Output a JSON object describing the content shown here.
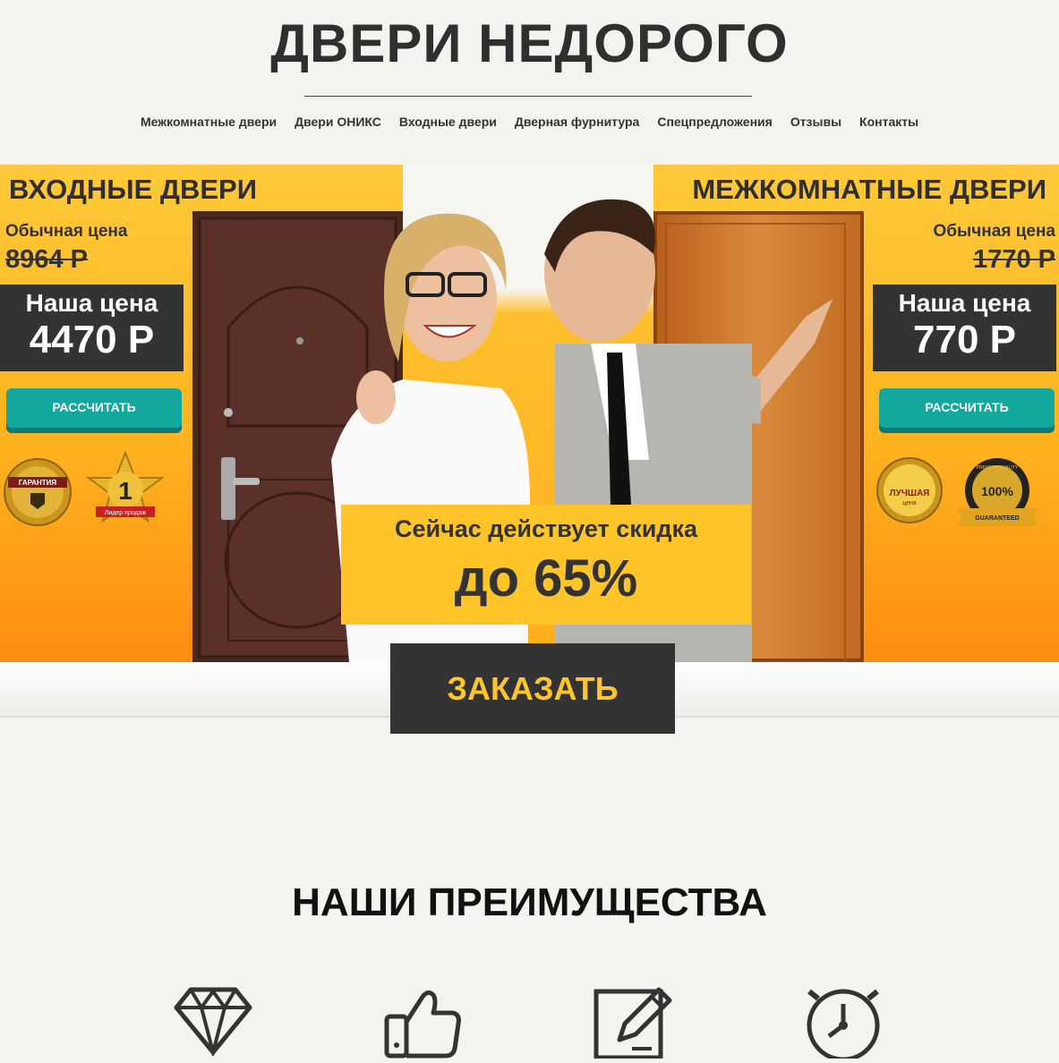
{
  "header": {
    "logo": "ДВЕРИ НЕДОРОГО",
    "nav": [
      "Межкомнатные двери",
      "Двери ОНИКС",
      "Входные двери",
      "Дверная фурнитура",
      "Спецпредложения",
      "Отзывы",
      "Контакты"
    ]
  },
  "hero": {
    "left": {
      "title": "ВХОДНЫЕ ДВЕРИ",
      "regular_label": "Обычная цена",
      "regular_price": "8964 Р",
      "our_label": "Наша цена",
      "our_price": "4470 Р",
      "button": "РАССЧИТАТЬ",
      "badges": {
        "guarantee": "ГАРАНТИЯ",
        "leader_num": "1",
        "leader_text": "Лидер продаж"
      }
    },
    "right": {
      "title": "МЕЖКОМНАТНЫЕ ДВЕРИ",
      "regular_label": "Обычная цена",
      "regular_price": "1770 Р",
      "our_label": "Наша цена",
      "our_price": "770 Р",
      "button": "РАССЧИТАТЬ",
      "badges": {
        "best": "ЛУЧШАЯ",
        "best_sub": "цена",
        "quality": "100%",
        "quality_top": "PREMIUM QUALITY",
        "quality_bottom": "GUARANTEED"
      }
    },
    "discount_line1": "Сейчас действует скидка",
    "discount_line2": "до 65%"
  },
  "order_button": "ЗАКАЗАТЬ",
  "advantages": {
    "title": "НАШИ ПРЕИМУЩЕСТВА",
    "icons": [
      "diamond-icon",
      "thumbs-up-icon",
      "edit-document-icon",
      "stopwatch-icon"
    ]
  },
  "colors": {
    "accent": "#ffc428",
    "dark": "#333333",
    "teal": "#13a89e",
    "orange": "#ff9a18"
  }
}
